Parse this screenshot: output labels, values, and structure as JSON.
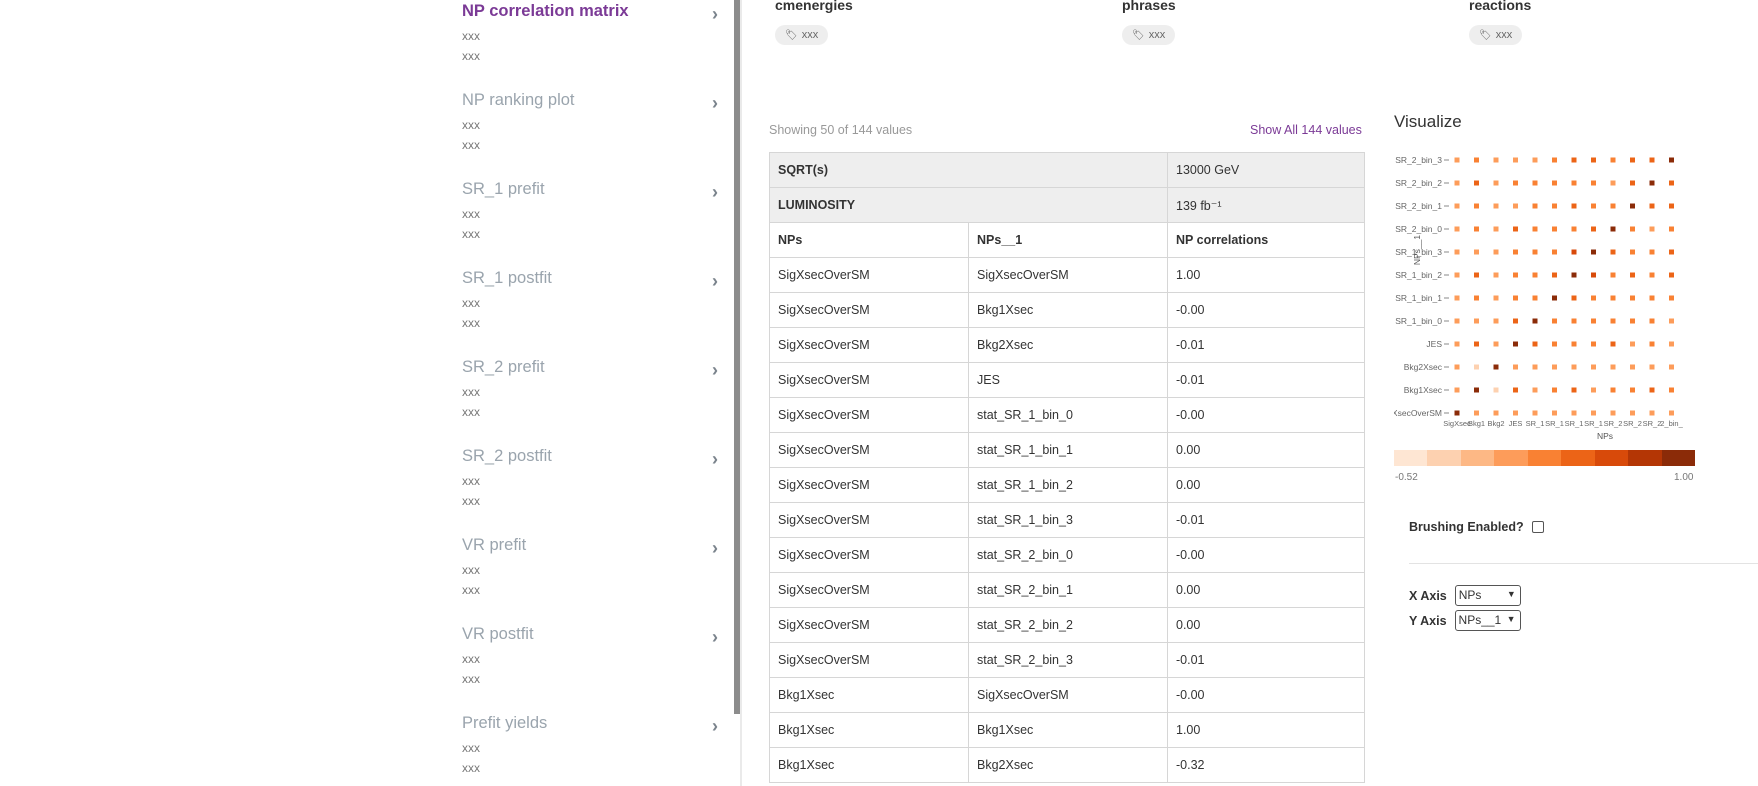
{
  "sidebar": {
    "items": [
      {
        "title": "NP correlation matrix",
        "sub1": "xxx",
        "sub2": "xxx",
        "active": true
      },
      {
        "title": "NP ranking plot",
        "sub1": "xxx",
        "sub2": "xxx"
      },
      {
        "title": "SR_1 prefit",
        "sub1": "xxx",
        "sub2": "xxx"
      },
      {
        "title": "SR_1 postfit",
        "sub1": "xxx",
        "sub2": "xxx"
      },
      {
        "title": "SR_2 prefit",
        "sub1": "xxx",
        "sub2": "xxx"
      },
      {
        "title": "SR_2 postfit",
        "sub1": "xxx",
        "sub2": "xxx"
      },
      {
        "title": "VR prefit",
        "sub1": "xxx",
        "sub2": "xxx"
      },
      {
        "title": "VR postfit",
        "sub1": "xxx",
        "sub2": "xxx"
      },
      {
        "title": "Prefit yields",
        "sub1": "xxx",
        "sub2": "xxx"
      }
    ],
    "chevron": "›"
  },
  "keywords": [
    {
      "title": "cmenergies",
      "tag": "xxx"
    },
    {
      "title": "phrases",
      "tag": "xxx"
    },
    {
      "title": "reactions",
      "tag": "xxx"
    }
  ],
  "table": {
    "showing": "Showing 50 of 144 values",
    "show_all": "Show All 144 values",
    "meta": [
      {
        "key": "SQRT(s)",
        "value": "13000 GeV"
      },
      {
        "key": "LUMINOSITY",
        "value": "139 fb⁻¹"
      }
    ],
    "headers": [
      "NPs",
      "NPs__1",
      "NP correlations"
    ],
    "rows": [
      [
        "SigXsecOverSM",
        "SigXsecOverSM",
        "1.00"
      ],
      [
        "SigXsecOverSM",
        "Bkg1Xsec",
        "-0.00"
      ],
      [
        "SigXsecOverSM",
        "Bkg2Xsec",
        "-0.01"
      ],
      [
        "SigXsecOverSM",
        "JES",
        "-0.01"
      ],
      [
        "SigXsecOverSM",
        "stat_SR_1_bin_0",
        "-0.00"
      ],
      [
        "SigXsecOverSM",
        "stat_SR_1_bin_1",
        "0.00"
      ],
      [
        "SigXsecOverSM",
        "stat_SR_1_bin_2",
        "0.00"
      ],
      [
        "SigXsecOverSM",
        "stat_SR_1_bin_3",
        "-0.01"
      ],
      [
        "SigXsecOverSM",
        "stat_SR_2_bin_0",
        "-0.00"
      ],
      [
        "SigXsecOverSM",
        "stat_SR_2_bin_1",
        "0.00"
      ],
      [
        "SigXsecOverSM",
        "stat_SR_2_bin_2",
        "0.00"
      ],
      [
        "SigXsecOverSM",
        "stat_SR_2_bin_3",
        "-0.01"
      ],
      [
        "Bkg1Xsec",
        "SigXsecOverSM",
        "-0.00"
      ],
      [
        "Bkg1Xsec",
        "Bkg1Xsec",
        "1.00"
      ],
      [
        "Bkg1Xsec",
        "Bkg2Xsec",
        "-0.32"
      ]
    ]
  },
  "visualize": {
    "title": "Visualize",
    "legend_min": "-0.52",
    "legend_max": "1.00",
    "legend_colors": [
      "#fee6d3",
      "#fdd1b0",
      "#fdb885",
      "#fd9c5a",
      "#f98133",
      "#ec6417",
      "#d84a0a",
      "#b43605",
      "#8b2b08"
    ],
    "brushing_label": "Brushing Enabled?",
    "x_axis_label": "X Axis",
    "x_axis_value": "NPs",
    "y_axis_label": "Y Axis",
    "y_axis_value": "NPs__1"
  },
  "chart_data": {
    "type": "heatmap",
    "title": "",
    "xlabel": "NPs",
    "ylabel": "NPs__1",
    "x_categories": [
      "SigXsecOverSM",
      "Bkg1Xsec",
      "Bkg2Xsec",
      "JES",
      "stat_SR_1_bin_0",
      "stat_SR_1_bin_1",
      "stat_SR_1_bin_2",
      "stat_SR_1_bin_3",
      "stat_SR_2_bin_0",
      "stat_SR_2_bin_1",
      "stat_SR_2_bin_2",
      "stat_SR_2_bin_3"
    ],
    "y_tick_labels": [
      "SR_2_bin_3",
      "SR_2_bin_2",
      "SR_2_bin_1",
      "SR_2_bin_0",
      "SR_1_bin_3",
      "SR_1_bin_2",
      "SR_1_bin_1",
      "SR_1_bin_0",
      "JES",
      "Bkg2Xsec",
      "Bkg1Xsec",
      "XsecOverSM"
    ],
    "x_tick_labels": [
      "SigXsec",
      "Bkg1",
      "Bkg2",
      "JES",
      "SR_1",
      "SR_1",
      "SR_1",
      "SR_1",
      "SR_2",
      "SR_2",
      "SR_2",
      "2_bin_"
    ],
    "color_range": [
      -0.52,
      1.0
    ],
    "matrix": [
      [
        -0.01,
        0.25,
        0.15,
        0.05,
        0.05,
        0.2,
        0.35,
        0.35,
        0.2,
        0.35,
        0.4,
        1.0
      ],
      [
        0.0,
        0.4,
        0.05,
        0.2,
        0.2,
        0.25,
        0.3,
        0.25,
        0.15,
        0.35,
        1.0,
        0.4
      ],
      [
        0.0,
        0.3,
        0.05,
        0.15,
        0.25,
        0.3,
        0.4,
        0.2,
        0.3,
        1.0,
        0.35,
        0.35
      ],
      [
        -0.0,
        0.3,
        0.05,
        0.4,
        0.2,
        0.3,
        0.3,
        0.35,
        1.0,
        0.3,
        0.15,
        0.2
      ],
      [
        -0.01,
        0.15,
        0.05,
        0.2,
        0.3,
        0.3,
        0.5,
        1.0,
        0.35,
        0.2,
        0.25,
        0.35
      ],
      [
        0.0,
        0.35,
        0.05,
        0.25,
        0.25,
        0.4,
        1.0,
        0.5,
        0.3,
        0.4,
        0.3,
        0.35
      ],
      [
        0.0,
        0.2,
        0.05,
        0.25,
        0.3,
        1.0,
        0.4,
        0.3,
        0.3,
        0.3,
        0.25,
        0.2
      ],
      [
        -0.0,
        0.15,
        0.05,
        0.4,
        1.0,
        0.3,
        0.25,
        0.3,
        0.2,
        0.25,
        0.2,
        0.05
      ],
      [
        -0.01,
        0.4,
        0.05,
        1.0,
        0.4,
        0.25,
        0.25,
        0.2,
        0.4,
        0.15,
        0.2,
        0.05
      ],
      [
        -0.01,
        -0.32,
        1.0,
        0.05,
        0.05,
        0.05,
        0.05,
        0.05,
        0.05,
        0.05,
        0.05,
        0.15
      ],
      [
        -0.0,
        1.0,
        -0.32,
        0.4,
        0.15,
        0.2,
        0.35,
        0.15,
        0.3,
        0.3,
        0.4,
        0.25
      ],
      [
        1.0,
        -0.0,
        -0.01,
        -0.01,
        -0.0,
        0.0,
        0.0,
        -0.01,
        -0.0,
        0.0,
        0.0,
        -0.01
      ]
    ]
  }
}
